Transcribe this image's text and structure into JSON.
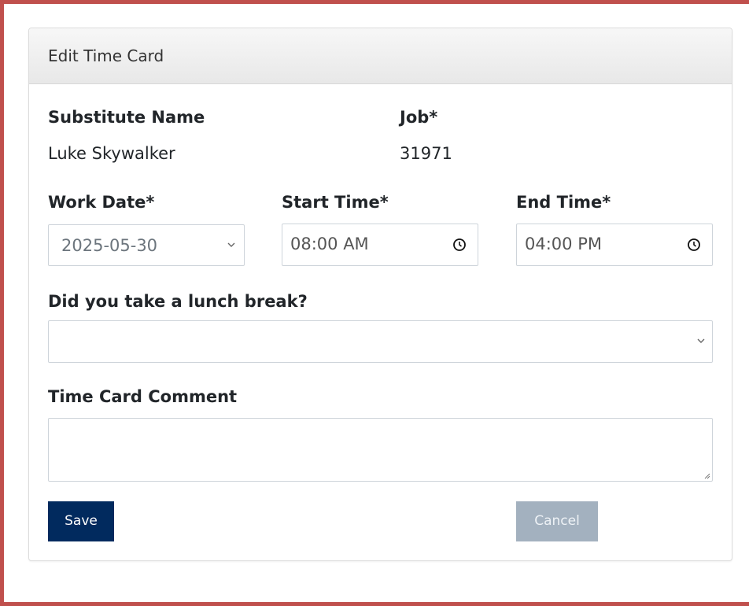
{
  "card": {
    "title": "Edit Time Card"
  },
  "substitute": {
    "label": "Substitute Name",
    "value": "Luke Skywalker"
  },
  "job": {
    "label": "Job*",
    "value": "31971"
  },
  "work_date": {
    "label": "Work Date*",
    "value": "2025-05-30",
    "icon": "chevron-down-icon"
  },
  "start_time": {
    "label": "Start Time*",
    "value": "08:00 AM",
    "icon": "clock-icon"
  },
  "end_time": {
    "label": "End Time*",
    "value": "04:00 PM",
    "icon": "clock-icon"
  },
  "lunch": {
    "label": "Did you take a lunch break?",
    "value": "",
    "icon": "chevron-down-icon"
  },
  "comment": {
    "label": "Time Card Comment",
    "value": ""
  },
  "actions": {
    "save_label": "Save",
    "cancel_label": "Cancel",
    "save_color": "#012a5e",
    "cancel_color": "#a3b1bf"
  },
  "colors": {
    "frame_border": "#c0504d"
  }
}
